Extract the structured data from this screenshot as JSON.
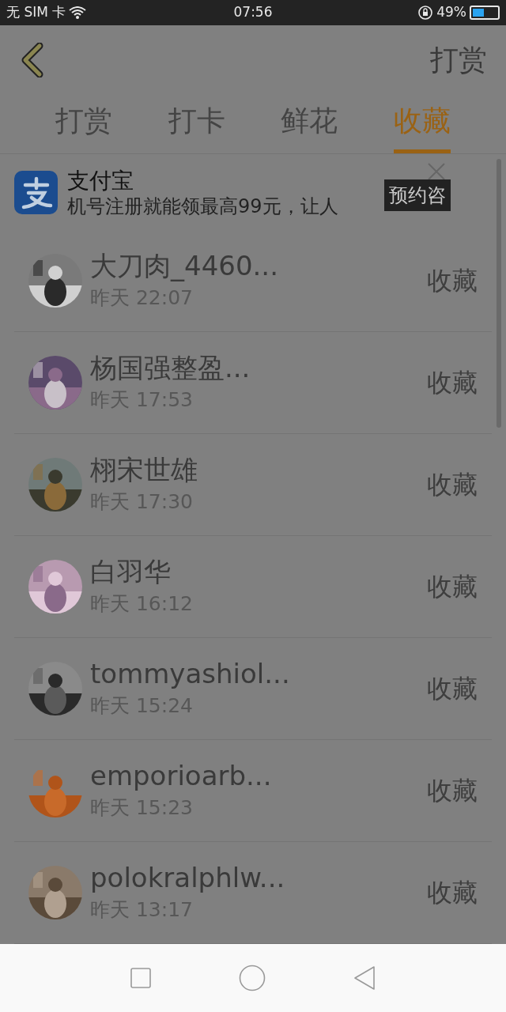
{
  "status_bar": {
    "carrier": "无 SIM 卡",
    "time": "07:56",
    "battery": "49%"
  },
  "header": {
    "action": "打赏"
  },
  "tabs": [
    {
      "label": "打赏",
      "selected": false
    },
    {
      "label": "打卡",
      "selected": false
    },
    {
      "label": "鲜花",
      "selected": false
    },
    {
      "label": "收藏",
      "selected": true
    }
  ],
  "ad": {
    "title": "支付宝",
    "text": "机号注册就能领最高99元，让人",
    "button": "预约咨"
  },
  "rows": [
    {
      "name": "大刀肉_4460...",
      "time": "昨天 22:07",
      "action": "收藏"
    },
    {
      "name": "杨国强整盈...",
      "time": "昨天 17:53",
      "action": "收藏"
    },
    {
      "name": "栩宋世雄",
      "time": "昨天 17:30",
      "action": "收藏"
    },
    {
      "name": "白羽华",
      "time": "昨天 16:12",
      "action": "收藏"
    },
    {
      "name": "tommyashiol...",
      "time": "昨天 15:24",
      "action": "收藏"
    },
    {
      "name": "emporioarb...",
      "time": "昨天 15:23",
      "action": "收藏"
    },
    {
      "name": "polokralphlw...",
      "time": "昨天 13:17",
      "action": "收藏"
    }
  ]
}
